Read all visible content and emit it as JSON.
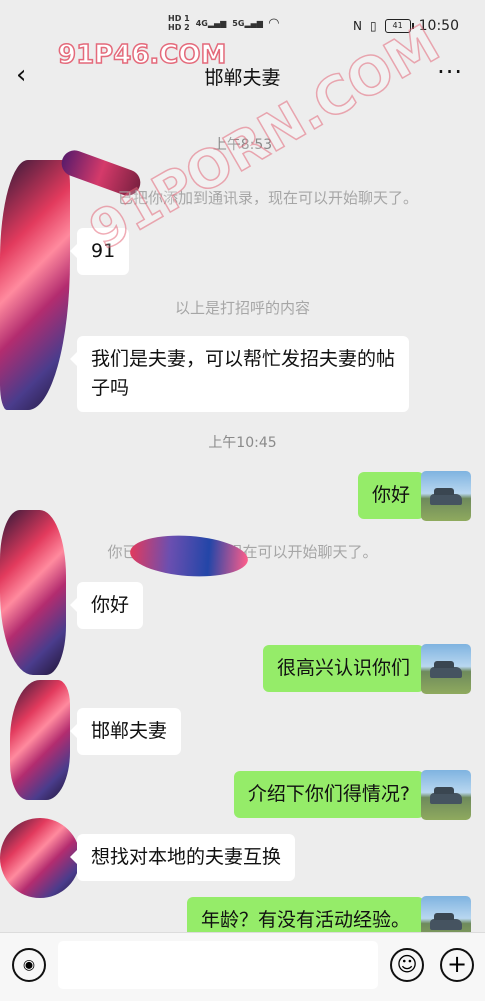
{
  "status_bar": {
    "sim1": "HD 1",
    "sim2": "HD 2",
    "signal1": "4G",
    "signal2": "5G",
    "battery": "41",
    "time": "10:50"
  },
  "watermark": {
    "top": "91P46.COM",
    "diagonal": "91PORN.COM"
  },
  "header": {
    "title": "邯郸夫妻",
    "back_icon": "chevron-left-icon",
    "more_icon": "more-dots-icon"
  },
  "messages": {
    "time1": "上午8:53",
    "sys1": "已把你添加到通讯录，现在可以开始聊天了。",
    "m1": "91",
    "sys2": "以上是打招呼的内容",
    "m2": "我们是夫妻，可以帮忙发招夫妻的帖子吗",
    "time2": "上午10:45",
    "m3": "你好",
    "sys3": "你已添加了对方，现在可以开始聊天了。",
    "m4": "你好",
    "m5": "很高兴认识你们",
    "m6": "邯郸夫妻",
    "m7": "介绍下你们得情况?",
    "m8": "想找对本地的夫妻互换",
    "m9": "年龄？有没有活动经验。"
  },
  "input_bar": {
    "voice_icon": "voice-icon",
    "emoji_icon": "emoji-icon",
    "plus_icon": "plus-icon",
    "value": ""
  }
}
